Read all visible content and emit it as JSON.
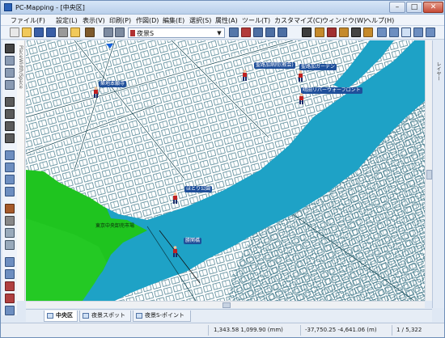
{
  "window": {
    "title": "PC-Mapping - [中央区]"
  },
  "menu": [
    "ファイル(F)",
    "設定(L)",
    "表示(V)",
    "印刷(P)",
    "作図(D)",
    "編集(E)",
    "選択(S)",
    "属性(A)",
    "ツール(T)",
    "カスタマイズ(C)",
    "ウィンドウ(W)",
    "ヘルプ(H)"
  ],
  "toolbar": {
    "layer_select_value": "夜景S"
  },
  "left_ruler_label": "PlaceWidth/Space",
  "side_panel_label": "レイヤー",
  "map": {
    "labels": {
      "daiba": "築地本願寺",
      "hospital": "聖路加病院(教会)",
      "garden": "聖路加ガーデン",
      "tsukuda": "晴田リバーウォーフロント",
      "park": "ほとり公園",
      "market": "東京中央卸売市場",
      "bridge": "勝鬨橋"
    }
  },
  "tabs": [
    {
      "label": "中央区"
    },
    {
      "label": "夜景スポット"
    },
    {
      "label": "夜景S-ポイント"
    }
  ],
  "status": {
    "coords_mm": "1,343.58  1,099.90  (mm)",
    "coords_m": "-37,750.25  -4,641.06  (m)",
    "page": "1 / 5,322"
  }
}
